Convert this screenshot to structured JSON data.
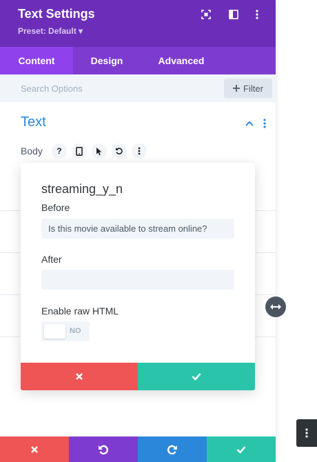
{
  "header": {
    "title": "Text Settings",
    "preset": "Preset: Default ▾",
    "icons": [
      "fullscreen-icon",
      "sidebar-toggle-icon",
      "more-options-icon"
    ],
    "bg_color": "#6c2eb9"
  },
  "tabs": [
    {
      "label": "Content",
      "active": true
    },
    {
      "label": "Design",
      "active": false
    },
    {
      "label": "Advanced",
      "active": false
    }
  ],
  "search": {
    "placeholder": "Search Options",
    "filter_label": "Filter"
  },
  "section": {
    "title": "Text",
    "body_label": "Body",
    "body_icons": [
      "help-icon",
      "mobile-icon",
      "cursor-icon",
      "undo-icon",
      "more-icon"
    ]
  },
  "dynamic_content_popup": {
    "title": "streaming_y_n",
    "before_label": "Before",
    "before_value": "Is this movie available to stream online?",
    "after_label": "After",
    "after_value": "",
    "raw_html_label": "Enable raw HTML",
    "raw_html_toggle": "NO"
  },
  "bottom_bar": {
    "buttons": [
      "discard",
      "undo",
      "redo",
      "save"
    ],
    "colors": {
      "discard": "#ef5555",
      "undo": "#7e3bd0",
      "redo": "#2b87da",
      "save": "#29c4a9"
    }
  }
}
